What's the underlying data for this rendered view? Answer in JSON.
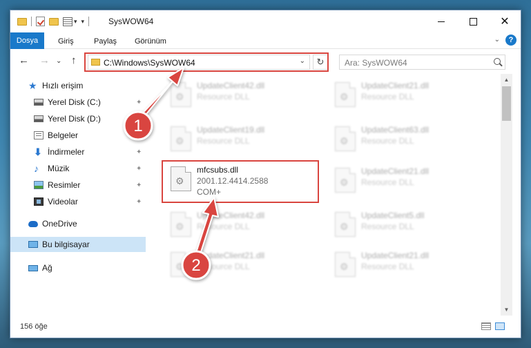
{
  "window": {
    "title": "SysWOW64",
    "controls": {
      "minimize": "",
      "maximize": "",
      "close": "✕"
    }
  },
  "ribbon": {
    "tabs": [
      {
        "label": "Dosya"
      },
      {
        "label": "Giriş"
      },
      {
        "label": "Paylaş"
      },
      {
        "label": "Görünüm"
      }
    ],
    "help": "?"
  },
  "address": {
    "path": "C:\\Windows\\SysWOW64",
    "search_placeholder": "Ara: SysWOW64"
  },
  "nav": {
    "items": [
      {
        "label": "Hızlı erişim",
        "icon": "star-icon"
      },
      {
        "label": "Yerel Disk (C:)",
        "icon": "disk-icon",
        "pinned": true
      },
      {
        "label": "Yerel Disk (D:)",
        "icon": "disk-icon",
        "pinned": true
      },
      {
        "label": "Belgeler",
        "icon": "documents-icon",
        "pinned": true
      },
      {
        "label": "İndirmeler",
        "icon": "download-icon",
        "pinned": true
      },
      {
        "label": "Müzik",
        "icon": "music-icon",
        "pinned": true
      },
      {
        "label": "Resimler",
        "icon": "pictures-icon",
        "pinned": true
      },
      {
        "label": "Videolar",
        "icon": "video-icon",
        "pinned": true
      },
      {
        "label": "OneDrive",
        "icon": "cloud-icon"
      },
      {
        "label": "Bu bilgisayar",
        "icon": "computer-icon",
        "selected": true
      },
      {
        "label": "Ağ",
        "icon": "network-icon"
      }
    ],
    "pin_glyph": "📌"
  },
  "files": {
    "left": [
      {
        "name": "UpdateClient42.dll",
        "desc": "Resource DLL"
      },
      {
        "name": "UpdateClient19.dll",
        "desc": "Resource DLL"
      },
      {
        "name": "mfcsubs.dll",
        "desc": "2001.12.4414.2588",
        "type": "COM+"
      },
      {
        "name": "UpdateClient42.dll",
        "desc": "Resource DLL"
      },
      {
        "name": "UpdateClient21.dll",
        "desc": "Resource DLL"
      }
    ],
    "right": [
      {
        "name": "UpdateClient21.dll",
        "desc": "Resource DLL"
      },
      {
        "name": "UpdateClient63.dll",
        "desc": "Resource DLL"
      },
      {
        "name": "UpdateClient21.dll",
        "desc": "Resource DLL"
      },
      {
        "name": "UpdateClient5.dll",
        "desc": "Resource DLL"
      },
      {
        "name": "UpdateClient21.dll",
        "desc": "Resource DLL"
      }
    ]
  },
  "status": {
    "count": "156 öğe"
  },
  "annotations": {
    "step1": "1",
    "step2": "2",
    "color": "#d9453f"
  }
}
